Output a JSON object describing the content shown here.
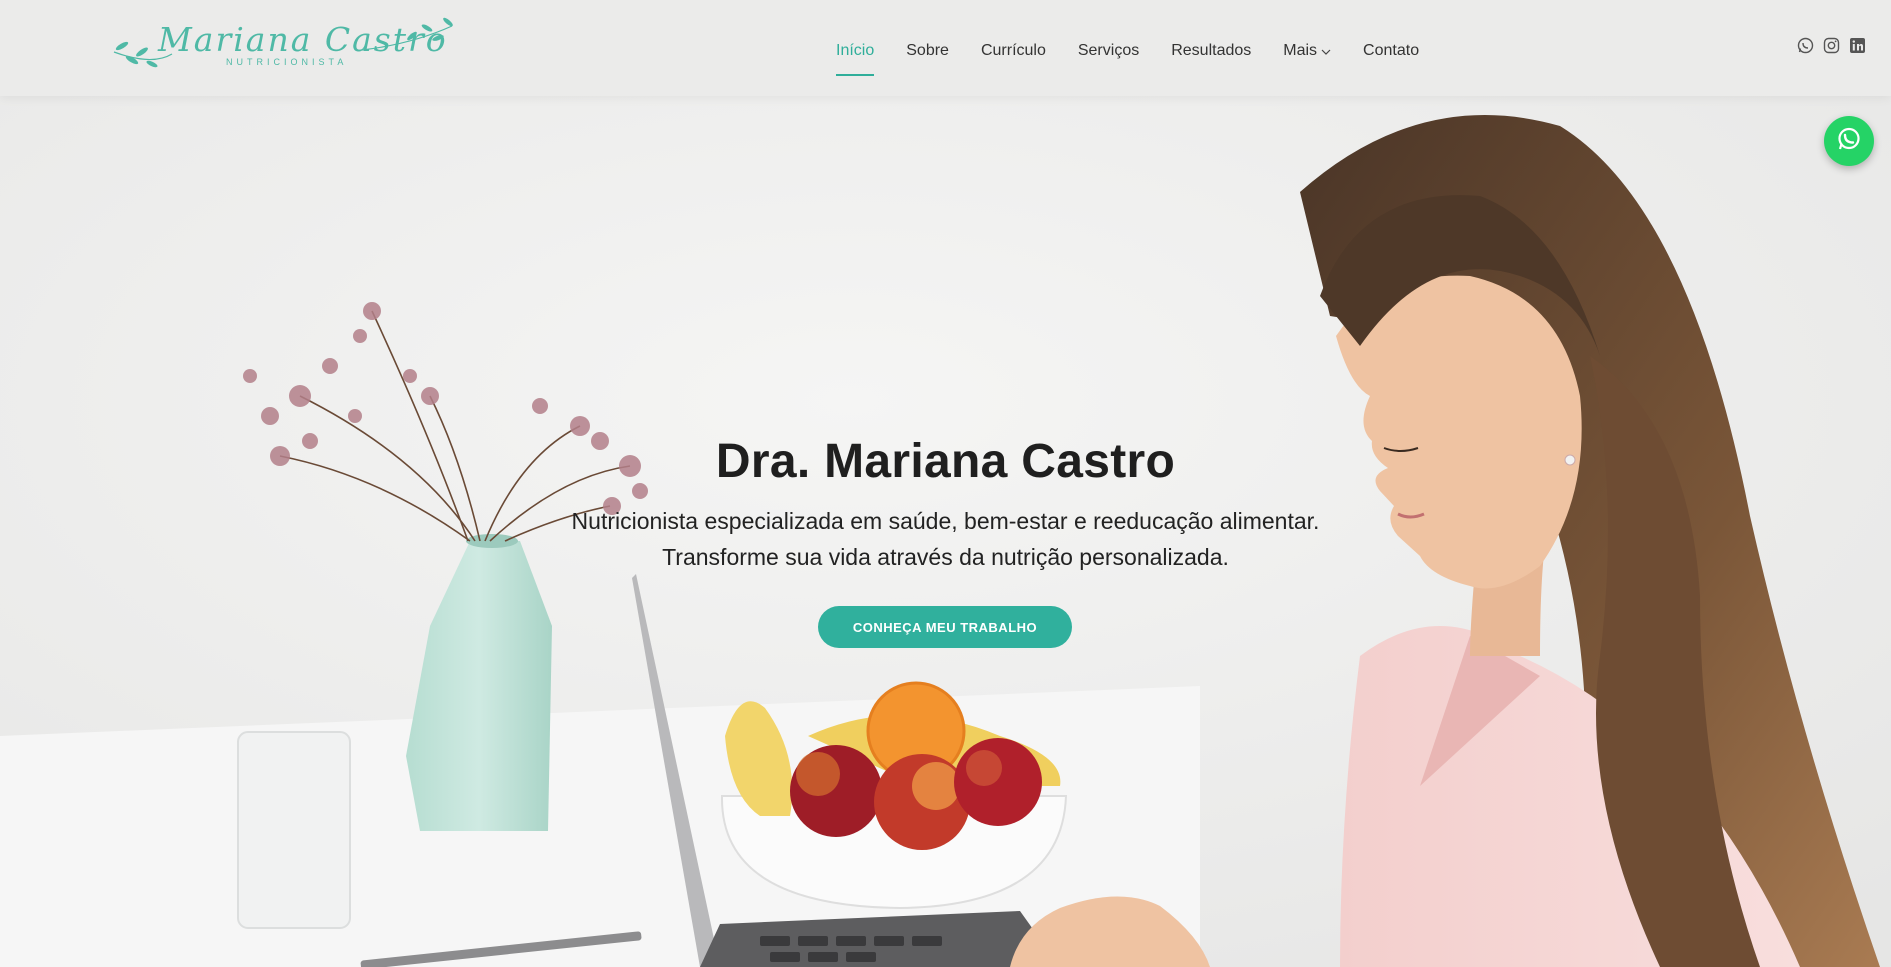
{
  "brand": {
    "name": "Mariana Castro",
    "tagline": "NUTRICIONISTA",
    "accent_color": "#30b09d"
  },
  "nav": {
    "items": [
      {
        "label": "Início",
        "active": true
      },
      {
        "label": "Sobre"
      },
      {
        "label": "Currículo"
      },
      {
        "label": "Serviços"
      },
      {
        "label": "Resultados"
      },
      {
        "label": "Mais",
        "has_dropdown": true
      },
      {
        "label": "Contato"
      }
    ]
  },
  "social": {
    "icons": [
      "whatsapp-icon",
      "instagram-icon",
      "linkedin-icon"
    ]
  },
  "hero": {
    "title": "Dra. Mariana Castro",
    "subtitle_line1": "Nutricionista especializada em saúde, bem-estar e reeducação alimentar.",
    "subtitle_line2": "Transforme sua vida através da nutrição personalizada.",
    "cta_label": "CONHEÇA MEU TRABALHO"
  },
  "floating": {
    "icon": "whatsapp-icon",
    "color": "#25d366"
  }
}
